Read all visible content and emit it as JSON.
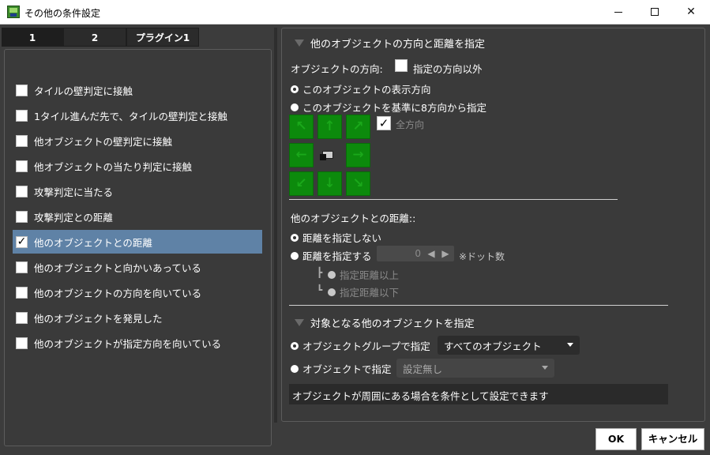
{
  "window": {
    "title": "その他の条件設定",
    "icon": "app-icon"
  },
  "tabs": [
    {
      "label": "1"
    },
    {
      "label": "2"
    },
    {
      "label": "プラグイン1"
    }
  ],
  "conditions": [
    {
      "label": "タイルの壁判定に接触",
      "checked": false
    },
    {
      "label": "1タイル進んだ先で、タイルの壁判定と接触",
      "checked": false
    },
    {
      "label": "他オブジェクトの壁判定に接触",
      "checked": false
    },
    {
      "label": "他オブジェクトの当たり判定に接触",
      "checked": false
    },
    {
      "label": "攻撃判定に当たる",
      "checked": false
    },
    {
      "label": "攻撃判定との距離",
      "checked": false
    },
    {
      "label": "他のオブジェクトとの距離",
      "checked": true,
      "selected": true
    },
    {
      "label": "他のオブジェクトと向かいあっている",
      "checked": false
    },
    {
      "label": "他のオブジェクトの方向を向いている",
      "checked": false
    },
    {
      "label": "他のオブジェクトを発見した",
      "checked": false
    },
    {
      "label": "他のオブジェクトが指定方向を向いている",
      "checked": false
    }
  ],
  "direction_section": {
    "header": "他のオブジェクトの方向と距離を指定",
    "direction_label": "オブジェクトの方向:",
    "except_label": "指定の方向以外",
    "radio_display_direction": "このオブジェクトの表示方向",
    "radio_8dir": "このオブジェクトを基準に8方向から指定",
    "all_directions_label": "全方向",
    "all_directions_checked": true,
    "direction_glyphs": [
      "↖",
      "↑",
      "↗",
      "←",
      "→",
      "↙",
      "↓",
      "↘"
    ]
  },
  "distance_section": {
    "label": "他のオブジェクトとの距離::",
    "radio_no_distance": "距離を指定しない",
    "radio_set_distance": "距離を指定する",
    "distance_value": "0",
    "unit_note": "※ドット数",
    "radio_above": "指定距離以上",
    "radio_below": "指定距離以下"
  },
  "target_section": {
    "header": "対象となる他のオブジェクトを指定",
    "radio_group": "オブジェクトグループで指定",
    "group_value": "すべてのオブジェクト",
    "radio_object": "オブジェクトで指定",
    "object_value": "設定無し",
    "description": "オブジェクトが周囲にある場合を条件として設定できます"
  },
  "footer": {
    "ok_label": "OK",
    "cancel_label": "キャンセル"
  },
  "colors": {
    "background": "#3c3c3c",
    "selected_row": "#5f82a6",
    "direction_button": "#0c8a0c"
  }
}
